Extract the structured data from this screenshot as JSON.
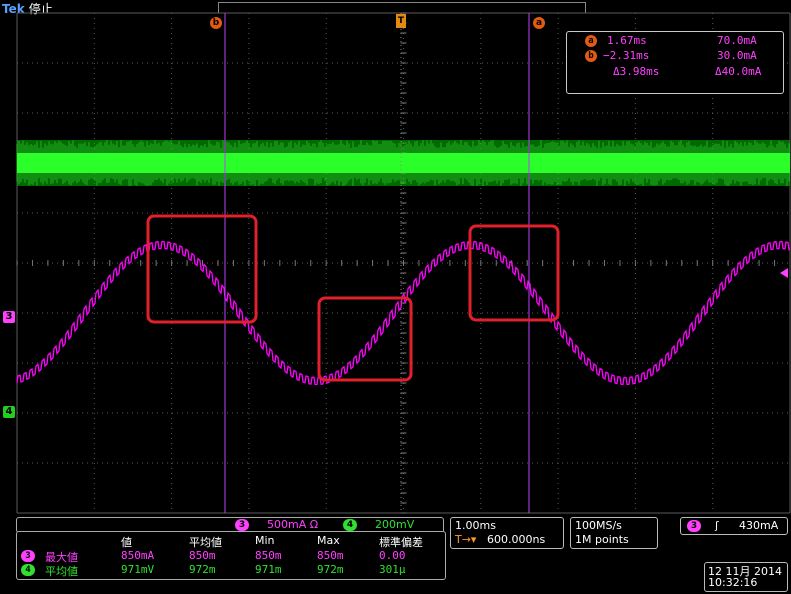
{
  "header": {
    "brand": "Tek",
    "state": "停止"
  },
  "cursor_labels": {
    "a": "a",
    "b": "b",
    "trigger": "T"
  },
  "cursor_readout": {
    "a_time": "1.67ms",
    "a_value": "70.0mA",
    "b_time": "−2.31ms",
    "b_value": "30.0mA",
    "delta_time": "Δ3.98ms",
    "delta_value": "Δ40.0mA"
  },
  "channel_markers": {
    "ch3": "3",
    "ch4": "4"
  },
  "vertical_settings": {
    "ch3_num": "3",
    "ch3_scale": "500mA Ω",
    "ch4_num": "4",
    "ch4_scale": "200mV"
  },
  "measurements": {
    "headers": [
      "値",
      "平均値",
      "Min",
      "Max",
      "標準偏差"
    ],
    "rows": [
      {
        "ch": "3",
        "name": "最大値",
        "values": [
          "850mA",
          "850m",
          "850m",
          "850m",
          "0.00"
        ]
      },
      {
        "ch": "4",
        "name": "平均値",
        "values": [
          "971mV",
          "972m",
          "971m",
          "972m",
          "301µ"
        ]
      }
    ]
  },
  "timebase": {
    "scale": "1.00ms",
    "trigger_pos": "600.000ns"
  },
  "acquisition": {
    "rate": "100MS/s",
    "points": "1M points"
  },
  "trigger": {
    "channel": "3",
    "slope": "ʃ",
    "level": "430mA"
  },
  "datetime": {
    "date": "12 11月 2014",
    "time": "10:32:16"
  },
  "colors": {
    "ch3": "#ff00ff",
    "ch4": "#00ff00",
    "cursor": "#e35a12",
    "highlight": "#e0202a"
  }
}
